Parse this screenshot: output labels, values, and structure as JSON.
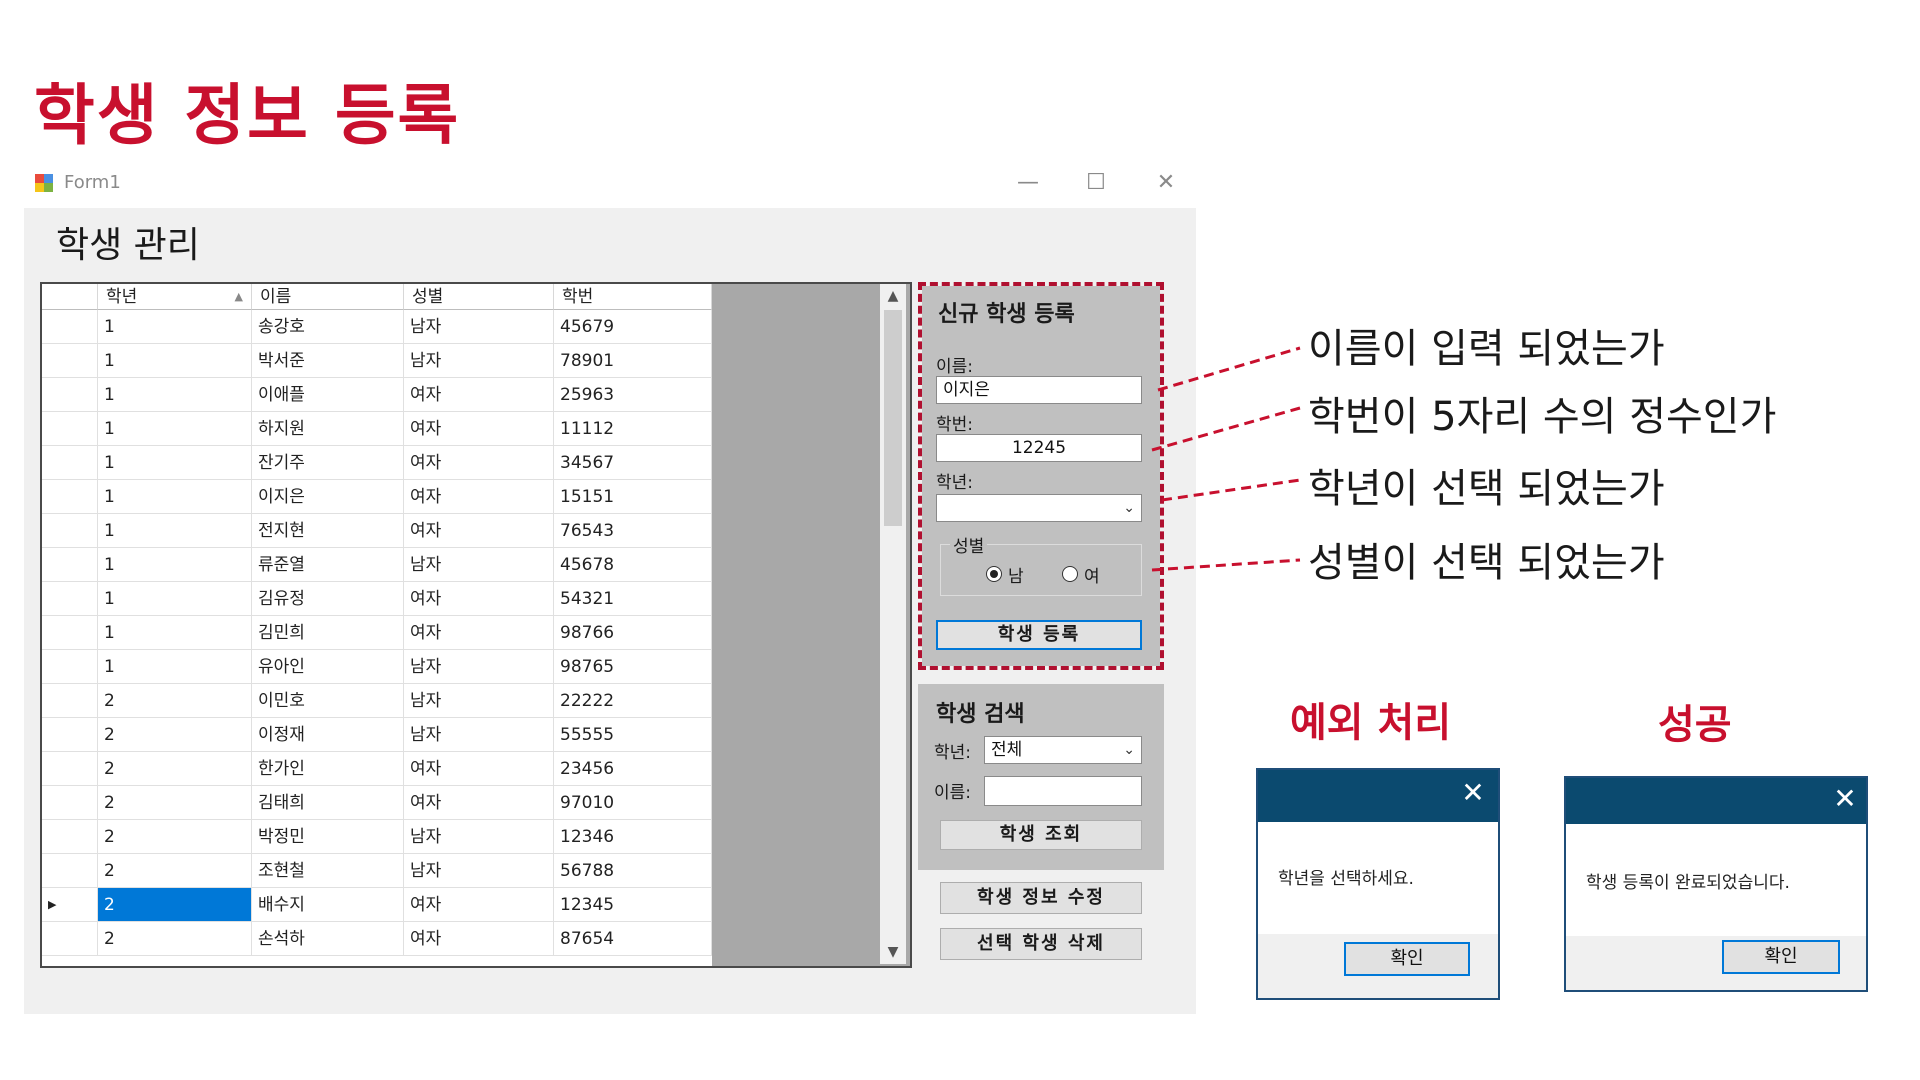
{
  "slide_title": "학생 정보 등록",
  "window": {
    "title": "Form1",
    "minimize": "—",
    "maximize": "☐",
    "close": "✕"
  },
  "form_heading": "학생 관리",
  "grid": {
    "headers": [
      "학년",
      "이름",
      "성별",
      "학번"
    ],
    "sort_arrow": "▲",
    "rows": [
      [
        "1",
        "송강호",
        "남자",
        "45679"
      ],
      [
        "1",
        "박서준",
        "남자",
        "78901"
      ],
      [
        "1",
        "이애플",
        "여자",
        "25963"
      ],
      [
        "1",
        "하지원",
        "여자",
        "11112"
      ],
      [
        "1",
        "잔기주",
        "여자",
        "34567"
      ],
      [
        "1",
        "이지은",
        "여자",
        "15151"
      ],
      [
        "1",
        "전지현",
        "여자",
        "76543"
      ],
      [
        "1",
        "류준열",
        "남자",
        "45678"
      ],
      [
        "1",
        "김유정",
        "여자",
        "54321"
      ],
      [
        "1",
        "김민희",
        "여자",
        "98766"
      ],
      [
        "1",
        "유아인",
        "남자",
        "98765"
      ],
      [
        "2",
        "이민호",
        "남자",
        "22222"
      ],
      [
        "2",
        "이정재",
        "남자",
        "55555"
      ],
      [
        "2",
        "한가인",
        "여자",
        "23456"
      ],
      [
        "2",
        "김태희",
        "여자",
        "97010"
      ],
      [
        "2",
        "박정민",
        "남자",
        "12346"
      ],
      [
        "2",
        "조현철",
        "남자",
        "56788"
      ],
      [
        "2",
        "배수지",
        "여자",
        "12345"
      ],
      [
        "2",
        "손석하",
        "여자",
        "87654"
      ]
    ],
    "current_row_marker": "▶",
    "scroll_up": "▲",
    "scroll_down": "▼"
  },
  "register_panel": {
    "title": "신규 학생 등록",
    "name_label": "이름:",
    "name_value": "이지은",
    "id_label": "학번:",
    "id_value": "12245",
    "grade_label": "학년:",
    "grade_value": "",
    "combo_arrow": "⌄",
    "gender_group": "성별",
    "male": "남",
    "female": "여",
    "submit": "학생 등록"
  },
  "search_panel": {
    "title": "학생 검색",
    "grade_label": "학년:",
    "grade_value": "전체",
    "name_label": "이름:",
    "name_value": "",
    "submit": "학생 조회"
  },
  "edit_button": "학생 정보 수정",
  "delete_button": "선택 학생 삭제",
  "annotations": [
    "이름이 입력 되었는가",
    "학번이 5자리 수의 정수인가",
    "학년이 선택 되었는가",
    "성별이 선택 되었는가"
  ],
  "dialogs": {
    "error_label": "예외 처리",
    "success_label": "성공",
    "error_message": "학년을 선택하세요.",
    "success_message": "학생 등록이 완료되었습니다.",
    "ok": "확인",
    "close": "✕"
  },
  "colors": {
    "accent_red": "#c8102e",
    "dialog_bar": "#0b4a6f",
    "selection": "#0078d7"
  }
}
